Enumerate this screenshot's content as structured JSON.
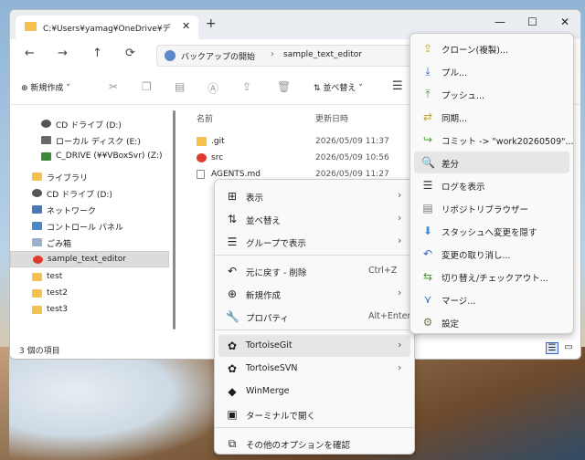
{
  "window": {
    "tab_title": "C:¥Users¥yamag¥OneDrive¥デ",
    "tab_close": "✕",
    "tab_new": "+",
    "minimize": "—",
    "maximize": "☐",
    "close": "✕"
  },
  "nav": {
    "back": "←",
    "forward": "→",
    "up": "↑",
    "refresh": "⟳",
    "address": [
      "バックアップの開始",
      "sample_text_editor"
    ]
  },
  "toolbar": {
    "new_label": "新規作成",
    "sort_label": "並べ替え"
  },
  "sidebar": {
    "items": [
      {
        "label": "CD ドライブ (D:)",
        "icon": "cd-drive-icon",
        "color": "#555555"
      },
      {
        "label": "ローカル ディスク (E:)",
        "icon": "disk-drive-icon",
        "color": "#6a6a6a"
      },
      {
        "label": "C_DRIVE (¥¥VBoxSvr) (Z:)",
        "icon": "network-drive-icon",
        "color": "#3a8a3a"
      },
      {
        "label": "ライブラリ",
        "icon": "library-icon",
        "color": "#f2c14e"
      },
      {
        "label": "CD ドライブ (D:)",
        "icon": "cd-drive-icon",
        "color": "#555555"
      },
      {
        "label": "ネットワーク",
        "icon": "network-icon",
        "color": "#4a78b8"
      },
      {
        "label": "コントロール パネル",
        "icon": "control-panel-icon",
        "color": "#4a88c8"
      },
      {
        "label": "ごみ箱",
        "icon": "recycle-bin-icon",
        "color": "#9ab0c8"
      },
      {
        "label": "sample_text_editor",
        "icon": "git-folder-icon",
        "color": "#e03a2e"
      },
      {
        "label": "test",
        "icon": "folder-icon",
        "color": "#f2c14e"
      },
      {
        "label": "test2",
        "icon": "folder-icon",
        "color": "#f2c14e"
      },
      {
        "label": "test3",
        "icon": "folder-icon",
        "color": "#f2c14e"
      }
    ]
  },
  "files": {
    "col_name": "名前",
    "col_date": "更新日時",
    "rows": [
      {
        "name": ".git",
        "date": "2026/05/09 11:37",
        "icon": "folder-icon",
        "color": "#f2c14e"
      },
      {
        "name": "src",
        "date": "2026/05/09 10:56",
        "icon": "git-folder-icon",
        "color": "#e03a2e"
      },
      {
        "name": "AGENTS.md",
        "date": "2026/05/09 11:27",
        "icon": "markdown-file-icon",
        "color": "#7a8aa0"
      }
    ]
  },
  "status": {
    "count": "3 個の項目"
  },
  "context_menu": {
    "items": [
      {
        "label": "表示",
        "icon": "⊞",
        "arrow": "›"
      },
      {
        "label": "並べ替え",
        "icon": "⇅",
        "arrow": "›"
      },
      {
        "label": "グループで表示",
        "icon": "☰",
        "arrow": "›"
      },
      {
        "label": "元に戻す - 削除",
        "icon": "↶",
        "shortcut": "Ctrl+Z"
      },
      {
        "label": "新規作成",
        "icon": "⊕",
        "arrow": "›"
      },
      {
        "label": "プロパティ",
        "icon": "🔧",
        "shortcut": "Alt+Enter"
      },
      {
        "label": "TortoiseGit",
        "icon": "✿",
        "arrow": "›"
      },
      {
        "label": "TortoiseSVN",
        "icon": "✿",
        "arrow": "›"
      },
      {
        "label": "WinMerge",
        "icon": "◆"
      },
      {
        "label": "ターミナルで開く",
        "icon": "▣"
      },
      {
        "label": "その他のオプションを確認",
        "icon": "⧉"
      }
    ]
  },
  "git_menu": {
    "items": [
      {
        "label": "クローン(複製)...",
        "icon": "⇪",
        "color": "#c9a321"
      },
      {
        "label": "プル...",
        "icon": "⤓",
        "color": "#3b67c9"
      },
      {
        "label": "プッシュ...",
        "icon": "⤒",
        "color": "#4a9a3a"
      },
      {
        "label": "同期...",
        "icon": "⇄",
        "color": "#c9a321"
      },
      {
        "label": "コミット -> \"work20260509\"...",
        "icon": "↪",
        "color": "#4a9a3a"
      },
      {
        "label": "差分",
        "icon": "🔍",
        "color": "#555555"
      },
      {
        "label": "ログを表示",
        "icon": "☰",
        "color": "#333333"
      },
      {
        "label": "リポジトリブラウザー",
        "icon": "▤",
        "color": "#777777"
      },
      {
        "label": "スタッシュへ変更を隠す",
        "icon": "⬇",
        "color": "#3b8fd9"
      },
      {
        "label": "変更の取り消し...",
        "icon": "↶",
        "color": "#3b67c9"
      },
      {
        "label": "切り替え/チェックアウト...",
        "icon": "⇆",
        "color": "#4a9a3a"
      },
      {
        "label": "マージ...",
        "icon": "⋎",
        "color": "#3b67c9"
      },
      {
        "label": "設定",
        "icon": "⚙",
        "color": "#7a7a5a"
      }
    ]
  }
}
